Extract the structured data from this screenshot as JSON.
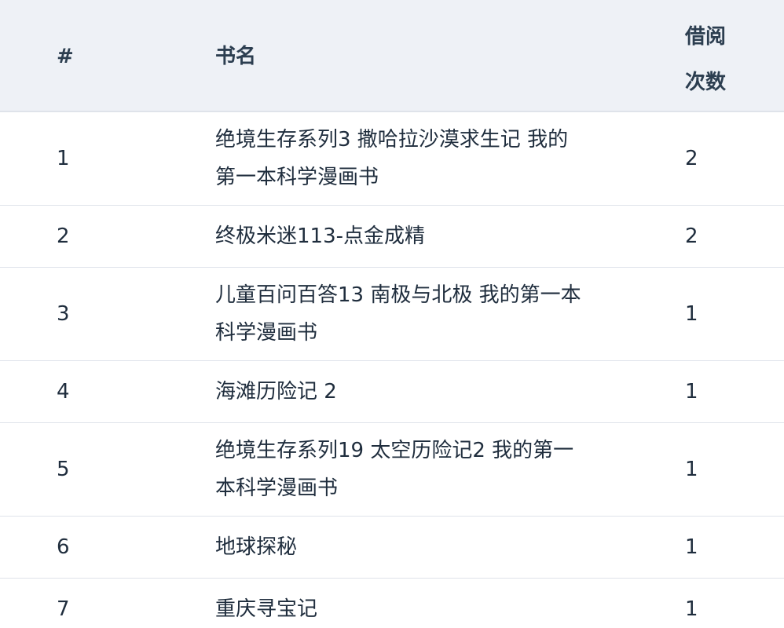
{
  "table": {
    "headers": {
      "num": "#",
      "title": "书名",
      "count": "借阅次数"
    },
    "rows": [
      {
        "num": "1",
        "title": "绝境生存系列3 撒哈拉沙漠求生记 我的第一本科学漫画书",
        "count": "2"
      },
      {
        "num": "2",
        "title": "终极米迷113-点金成精",
        "count": "2"
      },
      {
        "num": "3",
        "title": "儿童百问百答13 南极与北极 我的第一本科学漫画书",
        "count": "1"
      },
      {
        "num": "4",
        "title": "海滩历险记 2",
        "count": "1"
      },
      {
        "num": "5",
        "title": "绝境生存系列19 太空历险记2 我的第一本科学漫画书",
        "count": "1"
      },
      {
        "num": "6",
        "title": "地球探秘",
        "count": "1"
      },
      {
        "num": "7",
        "title": "重庆寻宝记",
        "count": "1"
      }
    ]
  }
}
